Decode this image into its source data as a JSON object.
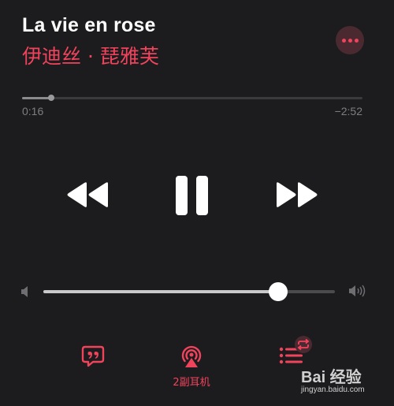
{
  "song": {
    "title": "La vie en rose",
    "artist": "伊迪丝 · 琵雅芙"
  },
  "progress": {
    "elapsed": "0:16",
    "remaining": "−2:52",
    "fraction": 0.086
  },
  "volume": {
    "level": 0.805
  },
  "airplay": {
    "label": "2副耳机"
  },
  "watermark": {
    "logo": "Bai 经验",
    "url": "jingyan.baidu.com"
  },
  "colors": {
    "background": "#1c1c1e",
    "accent": "#f2435c"
  },
  "icons": {
    "more": "more-icon",
    "rewind": "rewind-icon",
    "pause": "pause-icon",
    "fast_forward": "fast-forward-icon",
    "volume_low": "volume-low-icon",
    "volume_high": "volume-high-icon",
    "lyrics": "lyrics-icon",
    "airplay": "airplay-icon",
    "up_next": "up-next-icon"
  }
}
